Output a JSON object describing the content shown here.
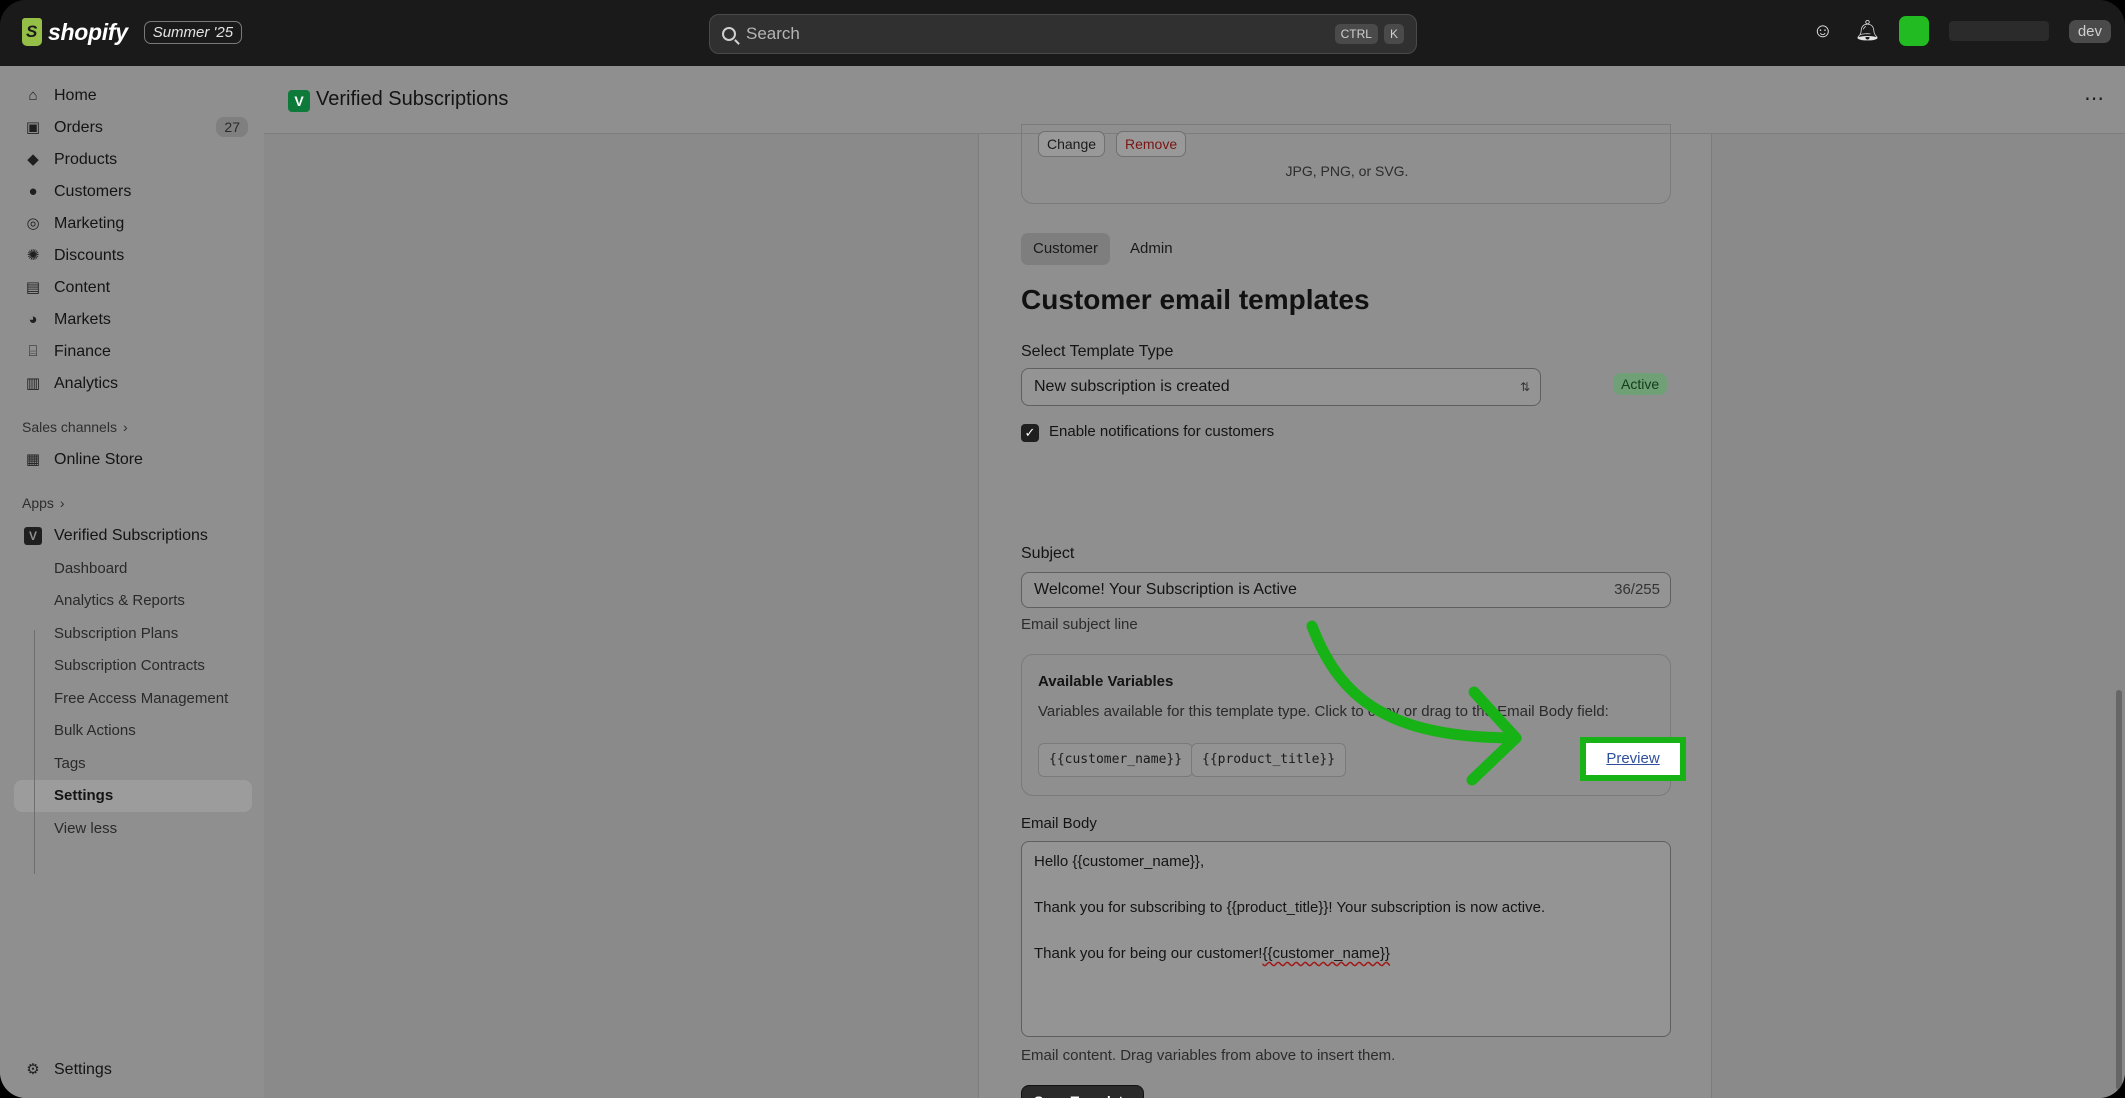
{
  "topbar": {
    "brand": "shopify",
    "edition": "Summer '25",
    "search_placeholder": "Search",
    "shortcut_keys": [
      "CTRL",
      "K"
    ],
    "dev_label": "dev"
  },
  "sidebar": {
    "items": [
      {
        "label": "Home",
        "icon": "home-icon"
      },
      {
        "label": "Orders",
        "icon": "inbox-icon",
        "count": "27"
      },
      {
        "label": "Products",
        "icon": "tag-icon"
      },
      {
        "label": "Customers",
        "icon": "person-icon"
      },
      {
        "label": "Marketing",
        "icon": "target-icon"
      },
      {
        "label": "Discounts",
        "icon": "discount-icon"
      },
      {
        "label": "Content",
        "icon": "image-icon"
      },
      {
        "label": "Markets",
        "icon": "globe-icon"
      },
      {
        "label": "Finance",
        "icon": "bank-icon"
      },
      {
        "label": "Analytics",
        "icon": "bar-chart-icon"
      }
    ],
    "sales_channels_label": "Sales channels",
    "online_store_label": "Online Store",
    "apps_label": "Apps",
    "app_name": "Verified Subscriptions",
    "app_subitems": [
      "Dashboard",
      "Analytics & Reports",
      "Subscription Plans",
      "Subscription Contracts",
      "Free Access Management",
      "Bulk Actions",
      "Tags",
      "Settings",
      "View less"
    ],
    "settings_label": "Settings"
  },
  "page": {
    "title": "Verified Subscriptions",
    "upload": {
      "change_label": "Change",
      "remove_label": "Remove",
      "hint": "JPG, PNG, or SVG."
    },
    "tabs": [
      "Customer",
      "Admin"
    ],
    "heading": "Customer email templates",
    "template_type_label": "Select Template Type",
    "template_type_value": "New subscription is created",
    "status": "Active",
    "notify_label": "Enable notifications for customers",
    "subject_label": "Subject",
    "subject_value": "Welcome! Your Subscription is Active",
    "subject_counter": "36/255",
    "subject_help": "Email subject line",
    "variables_title": "Available Variables",
    "variables_desc": "Variables available for this template type. Click to copy or drag to the Email Body field:",
    "variables": [
      "{{customer_name}}",
      "{{product_title}}"
    ],
    "body_label": "Email Body",
    "preview_label": "Preview",
    "body_lines": [
      "Hello {{customer_name}},",
      "",
      "Thank you for subscribing to {{product_title}}! Your subscription is now active.",
      "",
      "Thank you for being our customer!"
    ],
    "body_tail": "{{customer_name}}",
    "body_help": "Email content. Drag variables from above to insert them.",
    "save_label": "Save Template"
  },
  "colors": {
    "highlight": "#16b216",
    "brand_green": "#95bf47"
  }
}
